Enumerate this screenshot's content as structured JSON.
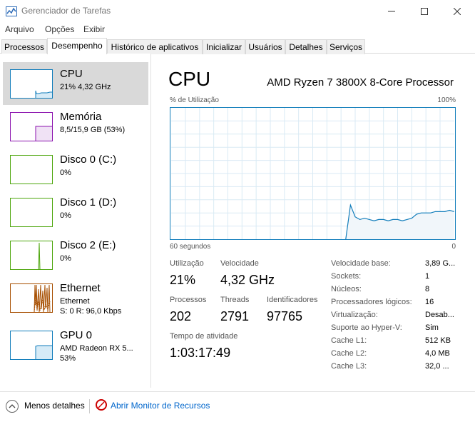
{
  "window": {
    "title": "Gerenciador de Tarefas",
    "min": "—",
    "max": "☐",
    "close": "✕"
  },
  "menu": [
    "Arquivo",
    "Opções",
    "Exibir"
  ],
  "tabs": [
    "Processos",
    "Desempenho",
    "Histórico de aplicativos",
    "Inicializar",
    "Usuários",
    "Detalhes",
    "Serviços"
  ],
  "active_tab": "Desempenho",
  "sidebar": [
    {
      "title": "CPU",
      "sub1": "21% 4,32 GHz",
      "sub2": "",
      "color": "#117dbb"
    },
    {
      "title": "Memória",
      "sub1": "8,5/15,9 GB (53%)",
      "sub2": "",
      "color": "#8b12ae"
    },
    {
      "title": "Disco 0 (C:)",
      "sub1": "0%",
      "sub2": "",
      "color": "#4da60c"
    },
    {
      "title": "Disco 1 (D:)",
      "sub1": "0%",
      "sub2": "",
      "color": "#4da60c"
    },
    {
      "title": "Disco 2 (E:)",
      "sub1": "0%",
      "sub2": "",
      "color": "#4da60c"
    },
    {
      "title": "Ethernet",
      "sub1": "Ethernet",
      "sub2": "S: 0 R: 96,0 Kbps",
      "color": "#a74f01"
    },
    {
      "title": "GPU 0",
      "sub1": "AMD Radeon RX 5...",
      "sub2": "53%",
      "color": "#117dbb"
    }
  ],
  "main": {
    "title": "CPU",
    "processor": "AMD Ryzen 7 3800X 8-Core Processor",
    "graph_label": "% de Utilização",
    "graph_max": "100%",
    "graph_time": "60 segundos",
    "graph_min": "0",
    "stats": {
      "util_label": "Utilização",
      "util_value": "21%",
      "speed_label": "Velocidade",
      "speed_value": "4,32 GHz",
      "proc_label": "Processos",
      "proc_value": "202",
      "threads_label": "Threads",
      "threads_value": "2791",
      "handles_label": "Identificadores",
      "handles_value": "97765",
      "uptime_label": "Tempo de atividade",
      "uptime_value": "1:03:17:49"
    },
    "details": [
      {
        "label": "Velocidade base:",
        "value": "3,89 G..."
      },
      {
        "label": "Sockets:",
        "value": "1"
      },
      {
        "label": "Núcleos:",
        "value": "8"
      },
      {
        "label": "Processadores lógicos:",
        "value": "16"
      },
      {
        "label": "Virtualização:",
        "value": "Desab..."
      },
      {
        "label": "Suporte ao Hyper-V:",
        "value": "Sim"
      },
      {
        "label": "Cache L1:",
        "value": "512 KB"
      },
      {
        "label": "Cache L2:",
        "value": "4,0 MB"
      },
      {
        "label": "Cache L3:",
        "value": "32,0 ..."
      }
    ]
  },
  "footer": {
    "less_details": "Menos detalhes",
    "resource_monitor": "Abrir Monitor de Recursos"
  },
  "chart_data": {
    "type": "area",
    "x": [
      0,
      1,
      2,
      3,
      4,
      5,
      6,
      7,
      8,
      9,
      10,
      11,
      12,
      13,
      14,
      15,
      16,
      17,
      18,
      19,
      20,
      21,
      22,
      23,
      24,
      25,
      26,
      27,
      28,
      29,
      30,
      31,
      32,
      33,
      34,
      35,
      36,
      37,
      38,
      39,
      40,
      41,
      42,
      43,
      44,
      45,
      46,
      47,
      48,
      49,
      50,
      51,
      52,
      53,
      54,
      55,
      56,
      57,
      58,
      59,
      60
    ],
    "values": [
      null,
      null,
      null,
      null,
      null,
      null,
      null,
      null,
      null,
      null,
      null,
      null,
      null,
      null,
      null,
      null,
      null,
      null,
      null,
      null,
      null,
      null,
      null,
      null,
      null,
      null,
      null,
      null,
      null,
      null,
      null,
      null,
      null,
      null,
      null,
      null,
      null,
      0,
      26,
      17,
      15,
      16,
      15,
      14,
      15,
      15,
      14,
      15,
      15,
      14,
      15,
      16,
      19,
      20,
      20,
      20,
      21,
      21,
      21,
      22,
      21
    ],
    "ylim": [
      0,
      100
    ],
    "xlabel": "60 segundos",
    "ylabel": "% de Utilização"
  }
}
